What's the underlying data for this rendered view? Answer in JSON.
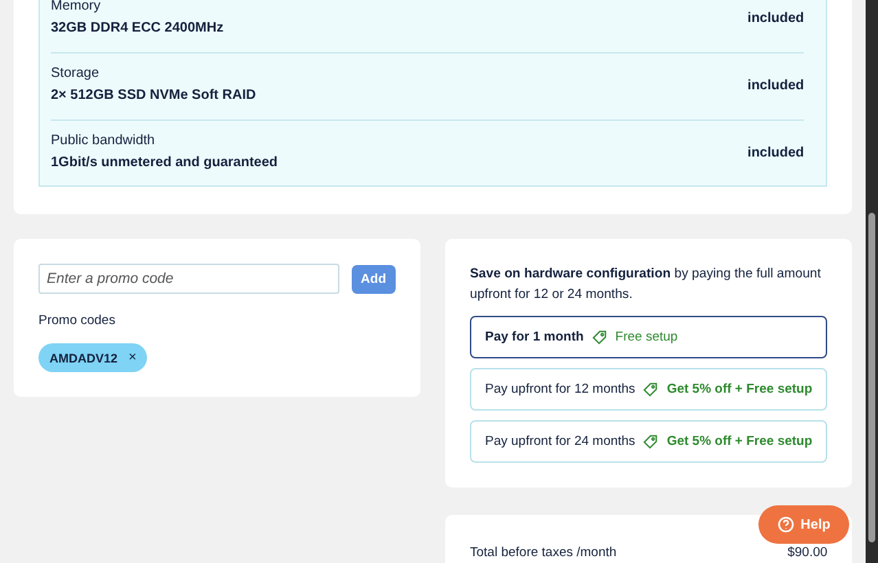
{
  "specs": [
    {
      "label": "Memory",
      "value": "32GB DDR4 ECC 2400MHz",
      "price": "included"
    },
    {
      "label": "Storage",
      "value": "2× 512GB SSD NVMe Soft RAID",
      "price": "included"
    },
    {
      "label": "Public bandwidth",
      "value": "1Gbit/s unmetered and guaranteed",
      "price": "included"
    }
  ],
  "promo": {
    "placeholder": "Enter a promo code",
    "button": "Add",
    "codes_label": "Promo codes",
    "codes": [
      {
        "code": "AMDADV12",
        "remove": "×"
      }
    ]
  },
  "billing": {
    "intro": "**Save on hardware configuration** by paying the full amount upfront for 12 or 24 months.",
    "options": [
      {
        "label": "Pay for 1 month",
        "offer": "Free setup",
        "selected": true
      },
      {
        "label": "Pay upfront for 12 months",
        "offer": "Get 5% off + Free setup",
        "selected": false
      },
      {
        "label": "Pay upfront for 24 months",
        "offer": "Get 5% off + Free setup",
        "selected": false
      }
    ]
  },
  "total": {
    "label": "Total before taxes /month",
    "value": "$90.00"
  },
  "help": {
    "label": "Help"
  }
}
